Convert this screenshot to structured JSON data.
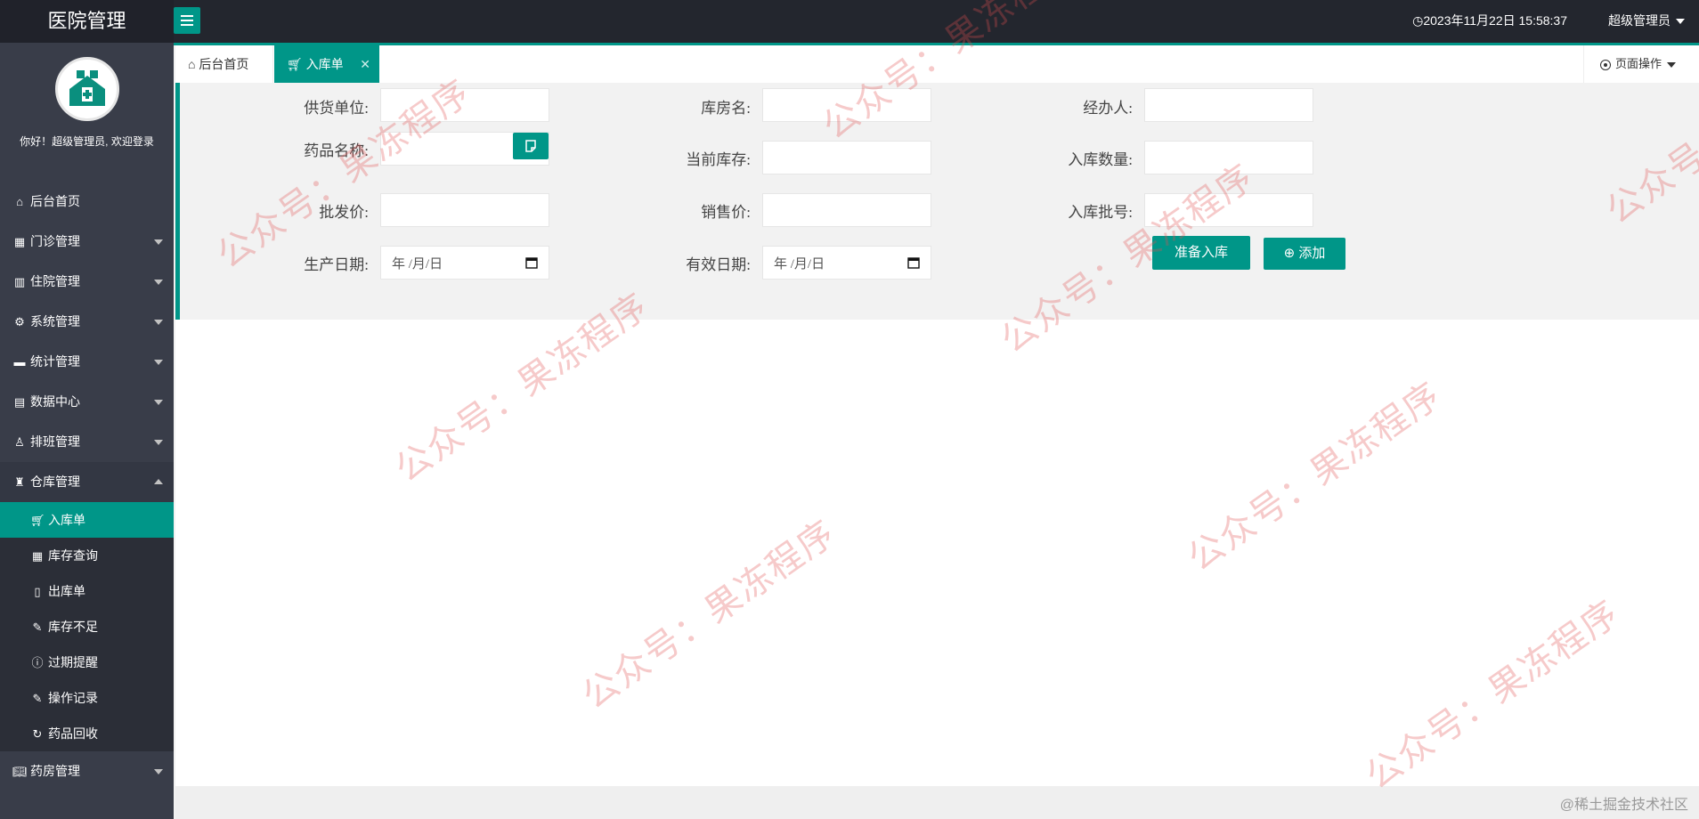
{
  "app": {
    "title": "医院管理"
  },
  "header": {
    "datetime": "2023年11月22日 15:58:37",
    "user": "超级管理员"
  },
  "sidebar": {
    "welcome": "你好！超级管理员, 欢迎登录",
    "items": [
      {
        "label": "后台首页",
        "icon": "home-icon"
      },
      {
        "label": "门诊管理",
        "icon": "grid-plus-icon"
      },
      {
        "label": "住院管理",
        "icon": "building-icon"
      },
      {
        "label": "系统管理",
        "icon": "gear-icon"
      },
      {
        "label": "统计管理",
        "icon": "chat-icon"
      },
      {
        "label": "数据中心",
        "icon": "document-icon"
      },
      {
        "label": "排班管理",
        "icon": "user-icon"
      },
      {
        "label": "仓库管理",
        "icon": "warehouse-icon"
      },
      {
        "label": "药房管理",
        "icon": "book-icon"
      }
    ],
    "sub_items": [
      {
        "label": "入库单",
        "icon": "cart-icon",
        "active": true
      },
      {
        "label": "库存查询",
        "icon": "calendar-icon"
      },
      {
        "label": "出库单",
        "icon": "file-icon"
      },
      {
        "label": "库存不足",
        "icon": "edit-file-icon"
      },
      {
        "label": "过期提醒",
        "icon": "info-icon"
      },
      {
        "label": "操作记录",
        "icon": "edit-file-icon"
      },
      {
        "label": "药品回收",
        "icon": "refresh-icon"
      }
    ]
  },
  "tabs": {
    "home": "后台首页",
    "active": "入库单",
    "page_ops": "页面操作"
  },
  "form": {
    "supplier_label": "供货单位:",
    "warehouse_label": "库房名:",
    "handler_label": "经办人:",
    "drug_name_label": "药品名称:",
    "current_stock_label": "当前库存:",
    "in_qty_label": "入库数量:",
    "wholesale_label": "批发价:",
    "sale_price_label": "销售价:",
    "batch_label": "入库批号:",
    "prod_date_label": "生产日期:",
    "expiry_label": "有效日期:",
    "date_placeholder": "年 /月/日",
    "prepare_button": "准备入库",
    "add_button": "添加"
  },
  "watermark": "公众号：果冻程序",
  "footer": {
    "brand": "@稀土掘金技术社区"
  }
}
